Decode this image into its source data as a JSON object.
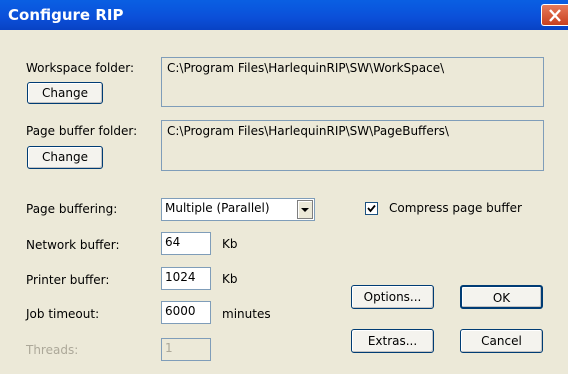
{
  "window": {
    "title": "Configure RIP"
  },
  "workspace": {
    "label": "Workspace folder:",
    "change_label": "Change",
    "path": "C:\\Program Files\\HarlequinRIP\\SW\\WorkSpace\\"
  },
  "pagebuffer": {
    "label": "Page buffer folder:",
    "change_label": "Change",
    "path": "C:\\Program Files\\HarlequinRIP\\SW\\PageBuffers\\"
  },
  "settings": {
    "page_buffering_label": "Page buffering:",
    "page_buffering_value": "Multiple (Parallel)",
    "compress_label": "Compress page buffer",
    "compress_checked": true,
    "network_buffer_label": "Network buffer:",
    "network_buffer_value": "64",
    "network_buffer_unit": "Kb",
    "printer_buffer_label": "Printer buffer:",
    "printer_buffer_value": "1024",
    "printer_buffer_unit": "Kb",
    "job_timeout_label": "Job timeout:",
    "job_timeout_value": "6000",
    "job_timeout_unit": "minutes",
    "threads_label": "Threads:",
    "threads_value": "1"
  },
  "buttons": {
    "options": "Options...",
    "ok": "OK",
    "extras": "Extras...",
    "cancel": "Cancel"
  },
  "icons": {
    "close": "close-icon",
    "dropdown": "chevron-down-icon",
    "check": "check-icon"
  },
  "colors": {
    "titlebar": "#0a5ae0",
    "dialog_bg": "#ece9d8",
    "close_button": "#c8401e"
  }
}
